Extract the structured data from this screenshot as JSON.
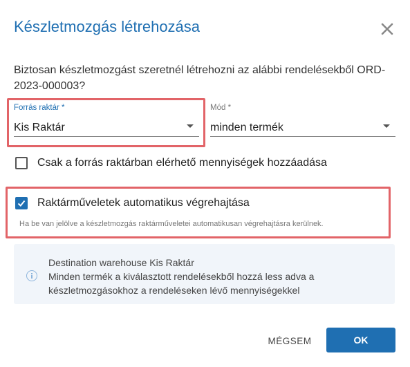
{
  "dialog": {
    "title": "Készletmozgás létrehozása",
    "confirm_text": "Biztosan készletmozgást szeretnél létrehozni az alábbi rendelésekből ORD-2023-000003?"
  },
  "source_warehouse": {
    "label": "Forrás raktár *",
    "value": "Kis Raktár"
  },
  "mode": {
    "label": "Mód *",
    "value": "minden termék"
  },
  "options": {
    "only_available": {
      "label": "Csak a forrás raktárban elérhető mennyiségek hozzáadása",
      "checked": false
    },
    "auto_execute": {
      "label": "Raktárműveletek automatikus végrehajtása",
      "checked": true,
      "hint": "Ha be van jelölve a készletmozgás raktárműveletei automatikusan végrehajtásra kerülnek."
    }
  },
  "info": {
    "line1": "Destination warehouse Kis Raktár",
    "line2": "Minden termék a kiválasztott rendelésekből hozzá less adva a",
    "line3": "készletmozgásokhoz a rendeléseken lévő mennyiségekkel"
  },
  "buttons": {
    "cancel": "MÉGSEM",
    "ok": "OK"
  },
  "colors": {
    "accent": "#1f6fb2",
    "highlight": "#e26468"
  }
}
